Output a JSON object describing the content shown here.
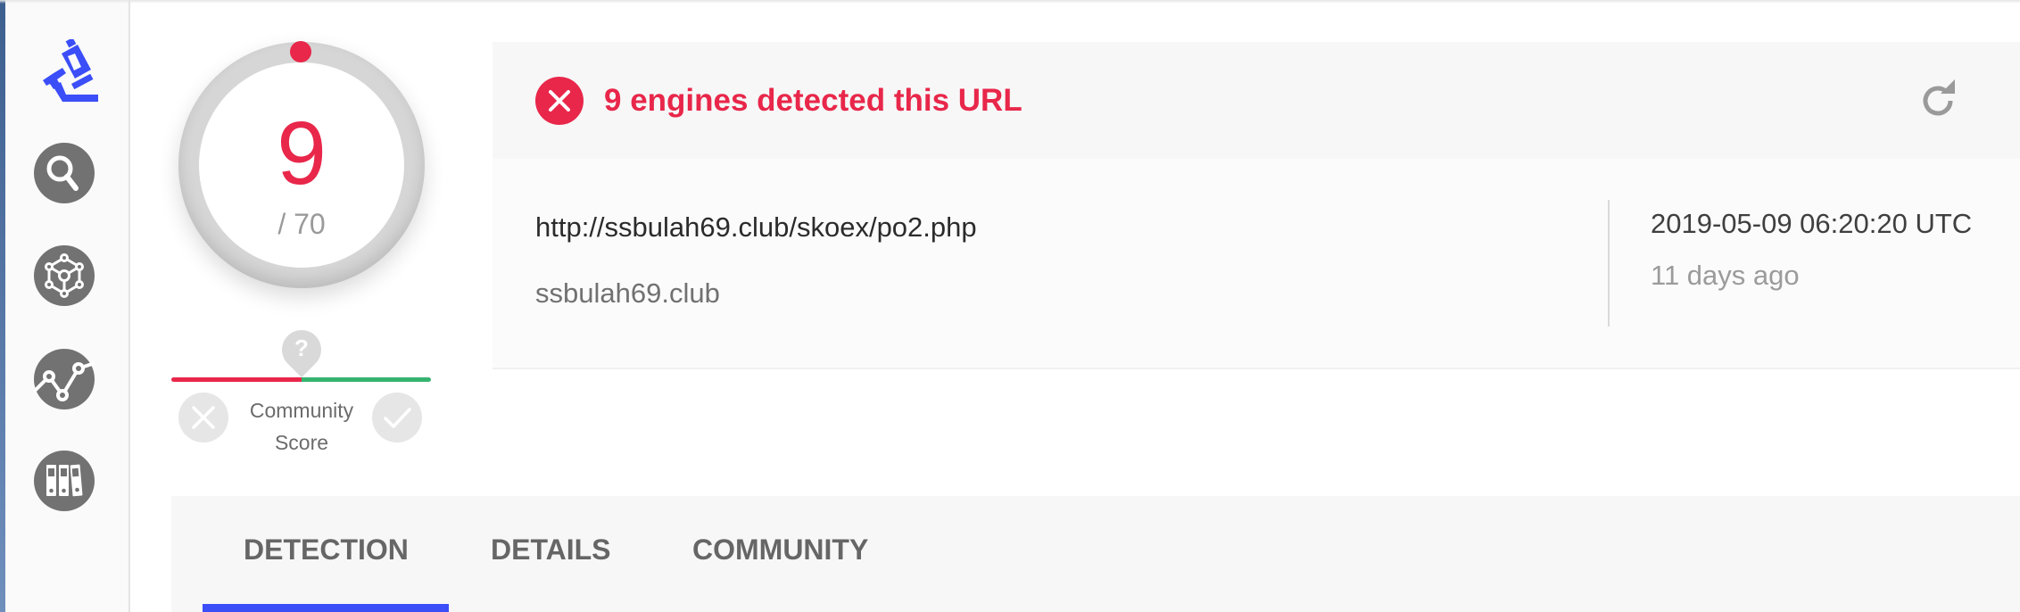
{
  "sidebar": {
    "items": [
      {
        "icon": "microscope-icon",
        "active": true
      },
      {
        "icon": "search-icon",
        "active": false
      },
      {
        "icon": "graph-cube-icon",
        "active": false
      },
      {
        "icon": "trend-line-icon",
        "active": false
      },
      {
        "icon": "binders-icon",
        "active": false
      }
    ]
  },
  "score": {
    "detections": "9",
    "total": "/ 70",
    "detection_fraction": 0.1286
  },
  "community": {
    "label_line1": "Community",
    "label_line2": "Score",
    "unknown_glyph": "?"
  },
  "summary": {
    "title": "9 engines detected this URL",
    "url": "http://ssbulah69.club/skoex/po2.php",
    "domain": "ssbulah69.club",
    "analysis_date": "2019-05-09 06:20:20 UTC",
    "relative_time": "11 days ago"
  },
  "tabs": [
    {
      "label": "DETECTION",
      "active": true
    },
    {
      "label": "DETAILS",
      "active": false
    },
    {
      "label": "COMMUNITY",
      "active": false
    }
  ],
  "colors": {
    "malicious": "#e8274a",
    "harmless": "#35b36f",
    "accent": "#3b4ef8",
    "icon_gray": "#727272"
  }
}
